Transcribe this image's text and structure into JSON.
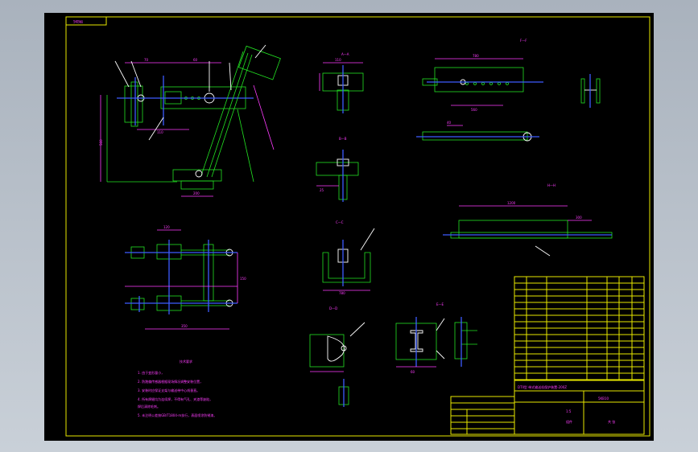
{
  "drawing": {
    "corner_tag": "5KB组",
    "section_labels": [
      "A—A",
      "B—B",
      "C—C",
      "D—D",
      "E—E",
      "F—F",
      "G—G",
      "H—H"
    ],
    "title_block": {
      "title": "DTII型 带式输送机保护装置-200Z",
      "drawing_no": "5KB10",
      "scale": "1:5",
      "sheet": "共 张",
      "material": "组件"
    },
    "notes": {
      "heading": "技术要求",
      "lines": [
        "1. 由于变形量小，",
        "2. 防跑偏传感器根据现场情况调整安装位置，",
        "3. 安装时应保证支架与输送带中心线垂直。",
        "4. 所有焊缝均为连续焊，不得有气孔、夹渣等缺陷，",
        "   焊后清除毛刺。",
        "5. 未注明公差按GB/T1804-m执行，表面喷涂防锈漆。"
      ]
    },
    "dims": [
      "780",
      "560",
      "350",
      "150",
      "70",
      "200",
      "110",
      "120",
      "60",
      "40",
      "25",
      "1200",
      "300",
      "250"
    ],
    "colors": {
      "frame": "#e8e800",
      "geometry": "#22e322",
      "centerline": "#3c5bff",
      "dimension": "#ff3cff",
      "hidden": "#ff2b2b"
    }
  }
}
